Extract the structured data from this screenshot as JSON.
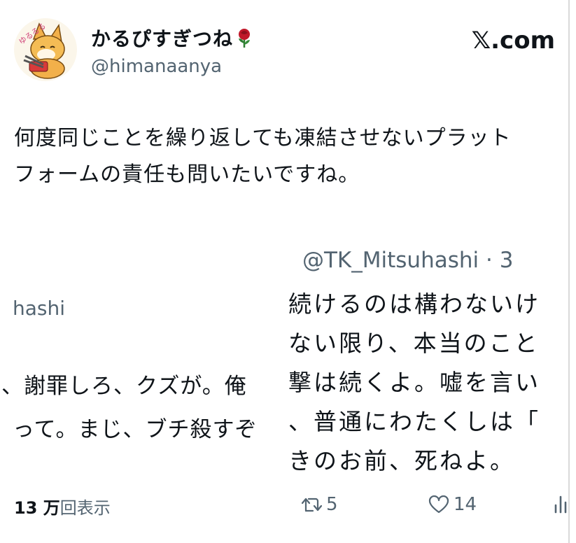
{
  "author": {
    "display_name": "かるぴすぎつね",
    "handle": "@himanaanya",
    "avatar_caption": "ゆるるる"
  },
  "site_label": "𝕏.com",
  "post": {
    "text_lines": [
      "何度同じことを繰り返しても凍結させないプラット",
      "フォームの責任も問いたいですね。"
    ]
  },
  "embedded_left": {
    "handle_fragment": "hashi",
    "lines": [
      "、謝罪しろ、クズが。俺",
      "って。まじ、ブチ殺すぞ"
    ]
  },
  "embedded_right": {
    "handle_fragment": "@TK_Mitsuhashi · 3",
    "lines": [
      "続けるのは構わないけ",
      "ない限り、本当のこと",
      "撃は続くよ。嘘を言い",
      "、普通にわたくしは「",
      "きのお前、死ねよ。"
    ]
  },
  "stats": {
    "views_count": "13 万",
    "views_label": "回表示",
    "retweets": "5",
    "likes": "14"
  },
  "colors": {
    "text": "#0f1419",
    "muted": "#536471",
    "rose": "#c0182a"
  }
}
